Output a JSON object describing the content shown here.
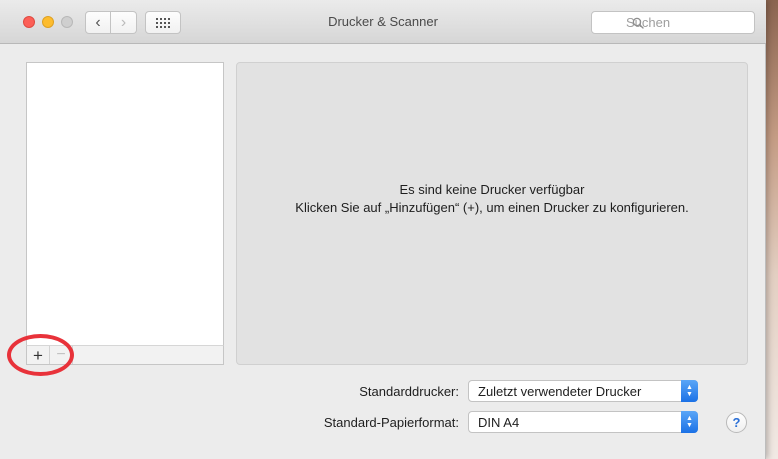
{
  "window": {
    "title": "Drucker & Scanner"
  },
  "toolbar": {
    "back_glyph": "‹",
    "forward_glyph": "›"
  },
  "search": {
    "placeholder": "Suchen"
  },
  "printer_list": {
    "items": [],
    "add_glyph": "+",
    "remove_glyph": "−"
  },
  "detail": {
    "line1": "Es sind keine Drucker verfügbar",
    "line2": "Klicken Sie auf „Hinzufügen“ (+), um einen Drucker zu konfigurieren."
  },
  "settings": {
    "default_printer_label": "Standarddrucker:",
    "default_printer_value": "Zuletzt verwendeter Drucker",
    "paper_label": "Standard-Papierformat:",
    "paper_value": "DIN A4"
  },
  "help": {
    "glyph": "?"
  },
  "colors": {
    "annotation_circle": "#e8323a",
    "popup_accent": "#1b71e6",
    "close": "#fc5f57",
    "minimize": "#fdbc2e"
  },
  "icons": [
    "close-icon",
    "minimize-icon",
    "zoom-icon",
    "chevron-left-icon",
    "chevron-right-icon",
    "grid-icon",
    "search-icon",
    "plus-icon",
    "minus-icon",
    "updown-arrows-icon",
    "help-icon"
  ]
}
